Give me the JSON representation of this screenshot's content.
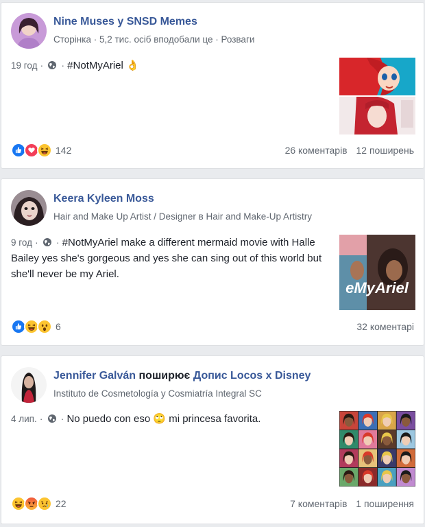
{
  "posts": [
    {
      "author": "Nine Muses у SNSD Memes",
      "sub": "Сторінка · 5,2 тис. осіб вподобали це · Розваги",
      "time": "19 год",
      "separator": "·",
      "text": "#NotMyAriel 👌",
      "reactions": [
        "like-icon",
        "love-icon",
        "haha-icon"
      ],
      "reaction_count": "142",
      "comments": "26 коментарів",
      "shares": "12 поширень"
    },
    {
      "author": "Keera Kyleen Moss",
      "sub": "Hair and Make Up Artist / Designer в Hair and Make-Up Artistry",
      "time": "9 год",
      "separator": "·",
      "text": "#NotMyAriel make a different mermaid movie with Halle Bailey yes she's gorgeous and yes she can sing out of this world but she'll never be my Ariel.",
      "thumb_caption": "eMyAriel",
      "reactions": [
        "like-icon",
        "haha-icon",
        "wow-icon"
      ],
      "reaction_count": "6",
      "comments": "32 коментарі"
    },
    {
      "author": "Jennifer Galván",
      "verb": "поширює",
      "shared_page": "Допис Locos x Disney",
      "sub": "Instituto de Cosmetología y Cosmiatría Integral SC",
      "time": "4 лип.",
      "separator": "·",
      "text": "No puedo con eso 🙄 mi princesa favorita.",
      "reactions": [
        "haha-icon",
        "angry-icon",
        "sad-icon"
      ],
      "reaction_count": "22",
      "comments": "7 коментарів",
      "shares": "1 поширення"
    }
  ],
  "colors": {
    "link": "#385898",
    "meta": "#606770",
    "like": "#1877f2",
    "love": "#f33e58",
    "emoji": "#fcc430"
  }
}
